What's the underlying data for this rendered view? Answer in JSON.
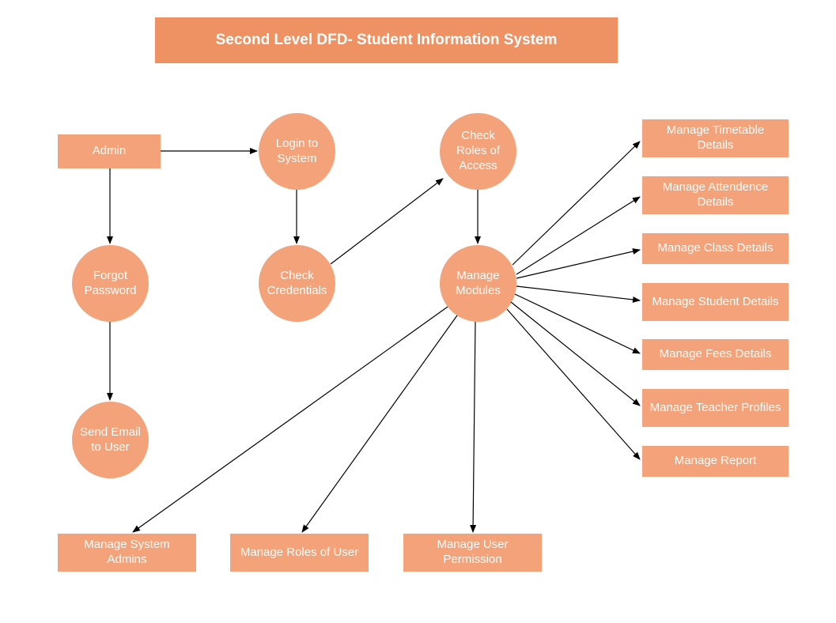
{
  "title": "Second Level DFD- Student Information System",
  "nodes": {
    "admin": "Admin",
    "login": "Login to System",
    "forgot": "Forgot Password",
    "sendEmail": "Send Email to User",
    "checkCred": "Check Credentials",
    "checkRoles": "Check Roles of Access",
    "manageModules": "Manage Modules",
    "manageSystemAdmins": "Manage System Admins",
    "manageRolesUser": "Manage Roles of User",
    "manageUserPerm": "Manage User Permission",
    "manageTimetable": "Manage Timetable Details",
    "manageAttendance": "Manage Attendence Details",
    "manageClass": "Manage Class Details",
    "manageStudent": "Manage Student Details",
    "manageFees": "Manage Fees Details",
    "manageTeacher": "Manage Teacher Profiles",
    "manageReport": "Manage Report"
  }
}
